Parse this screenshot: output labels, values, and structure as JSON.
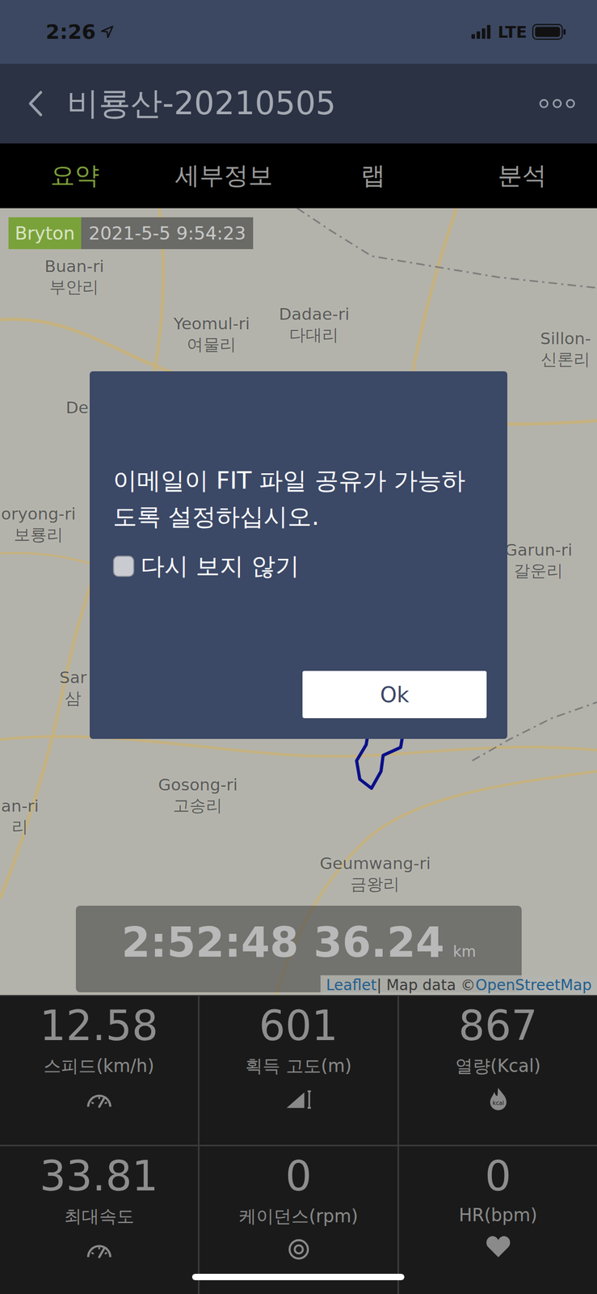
{
  "status_bar": {
    "time": "2:26",
    "network": "LTE"
  },
  "nav": {
    "title": "비룡산-20210505"
  },
  "tabs": [
    {
      "label": "요약",
      "selected": true
    },
    {
      "label": "세부정보",
      "selected": false
    },
    {
      "label": "랩",
      "selected": false
    },
    {
      "label": "분석",
      "selected": false
    }
  ],
  "map": {
    "badge": {
      "source": "Bryton",
      "datetime": "2021-5-5 9:54:23"
    },
    "labels": [
      {
        "latin": "Buan-ri",
        "korean": "부안리"
      },
      {
        "latin": "Yeomul-ri",
        "korean": "여물리"
      },
      {
        "latin": "Dadae-ri",
        "korean": "다대리"
      },
      {
        "latin": "Sillon-",
        "korean": "신론리"
      },
      {
        "latin": "De",
        "korean": ""
      },
      {
        "latin": "oryong-ri",
        "korean": "보룡리"
      },
      {
        "latin": "Garun-ri",
        "korean": "갈운리"
      },
      {
        "latin": "Sar",
        "korean": "삼"
      },
      {
        "latin": "Gosong-ri",
        "korean": "고송리"
      },
      {
        "latin": "an-ri",
        "korean": "리"
      },
      {
        "latin": "Geumwang-ri",
        "korean": "금왕리"
      }
    ],
    "summary": {
      "duration": "2:52:48",
      "distance": "36.24",
      "unit": "km"
    },
    "attribution": {
      "leaflet": "Leaflet",
      "separator": "| Map data ©",
      "osm": "OpenStreetMap"
    }
  },
  "stats": [
    {
      "value": "12.58",
      "label": "스피드(km/h)",
      "kind": "speed"
    },
    {
      "value": "601",
      "label": "획득 고도(m)",
      "kind": "elevation"
    },
    {
      "value": "867",
      "label": "열량(Kcal)",
      "kind": "calorie",
      "icon_text": "kcal"
    },
    {
      "value": "33.81",
      "label": "최대속도",
      "kind": "speed"
    },
    {
      "value": "0",
      "label": "케이던스(rpm)",
      "kind": "cadence"
    },
    {
      "value": "0",
      "label": "HR(bpm)",
      "kind": "heart"
    }
  ],
  "dialog": {
    "message": "이메일이 FIT 파일 공유가 가능하도록 설정하십시오.",
    "checkbox": {
      "label": "다시 보지 않기",
      "checked": false
    },
    "button": "Ok"
  }
}
